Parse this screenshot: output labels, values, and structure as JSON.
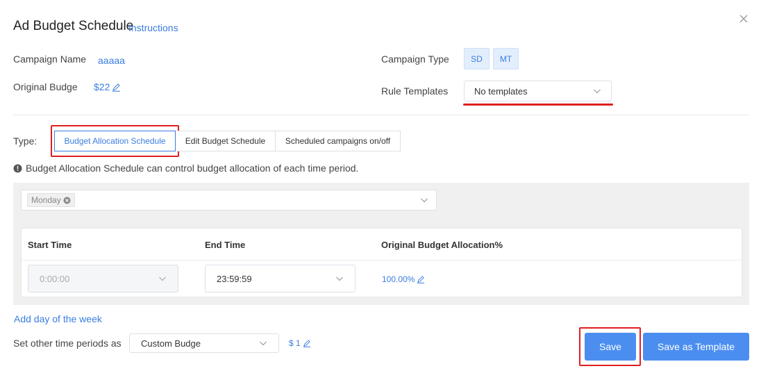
{
  "header": {
    "title": "Ad Budget Schedule",
    "instructions_link": "Instructions"
  },
  "campaign": {
    "name_label": "Campaign Name",
    "name_value": "aaaaa",
    "budget_label": "Original Budge",
    "budget_value": "$22",
    "type_label": "Campaign Type",
    "types": [
      "SD",
      "MT"
    ],
    "templates_label": "Rule Templates",
    "templates_value": "No templates"
  },
  "type_selector": {
    "label": "Type:",
    "options": [
      "Budget Allocation Schedule",
      "Edit Budget Schedule",
      "Scheduled campaigns on/off"
    ],
    "selected": "Budget Allocation Schedule"
  },
  "info_text": "Budget Allocation Schedule can control budget allocation of each time period.",
  "day_selector": {
    "chips": [
      "Monday"
    ]
  },
  "table": {
    "headers": [
      "Start Time",
      "End Time",
      "Original Budget Allocation%"
    ],
    "rows": [
      {
        "start": "0:00:00",
        "end": "23:59:59",
        "allocation": "100.00%"
      }
    ]
  },
  "footer": {
    "add_day_link": "Add day of the week",
    "other_periods_label": "Set other time periods as",
    "other_periods_select": "Custom Budge",
    "other_periods_value": "$ 1",
    "save_label": "Save",
    "save_template_label": "Save as Template"
  },
  "colors": {
    "accent": "#3a7de0",
    "button": "#4b8ef0",
    "highlight": "#e01f1f"
  }
}
